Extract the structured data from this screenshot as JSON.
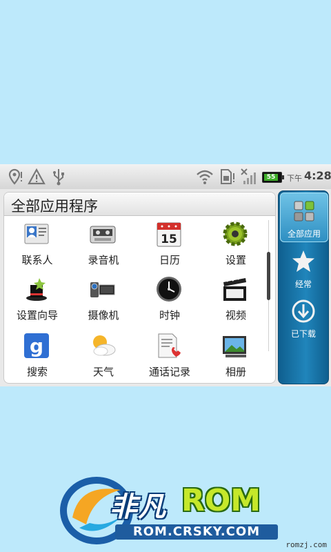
{
  "status_bar": {
    "icons": [
      "location-icon",
      "warning-icon",
      "usb-icon",
      "wifi-icon",
      "sim-warning-icon",
      "no-signal-icon"
    ],
    "battery_level": "55",
    "time_prefix": "下午",
    "time": "4:28"
  },
  "panel": {
    "title": "全部应用程序"
  },
  "apps": [
    {
      "label": "联系人",
      "icon": "contacts-icon"
    },
    {
      "label": "录音机",
      "icon": "recorder-icon"
    },
    {
      "label": "日历",
      "icon": "calendar-icon",
      "icon_text": "15"
    },
    {
      "label": "设置",
      "icon": "settings-icon"
    },
    {
      "label": "设置向导",
      "icon": "setup-wizard-icon"
    },
    {
      "label": "摄像机",
      "icon": "camcorder-icon"
    },
    {
      "label": "时钟",
      "icon": "clock-icon"
    },
    {
      "label": "视频",
      "icon": "video-icon"
    },
    {
      "label": "搜索",
      "icon": "google-search-icon",
      "icon_text": "g"
    },
    {
      "label": "天气",
      "icon": "weather-icon"
    },
    {
      "label": "通话记录",
      "icon": "call-log-icon"
    },
    {
      "label": "相册",
      "icon": "gallery-icon"
    }
  ],
  "tabs": [
    {
      "label": "全部应用",
      "icon": "grid-icon",
      "active": true
    },
    {
      "label": "经常",
      "icon": "star-icon",
      "active": false
    },
    {
      "label": "已下载",
      "icon": "download-icon",
      "active": false
    }
  ],
  "branding": {
    "logo_cn": "非凡",
    "logo_rom": "ROM",
    "logo_url": "ROM.CRSKY.COM",
    "watermark": "romzj.com"
  },
  "colors": {
    "background": "#bde9fb",
    "tab_bar": "#1a78ad",
    "tab_active": "#4aa9d6"
  }
}
